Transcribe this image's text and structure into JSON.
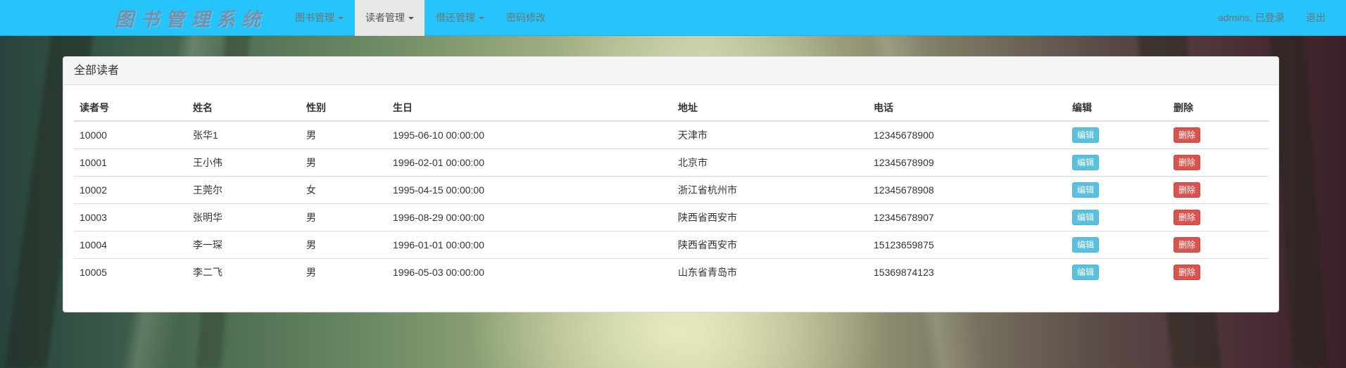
{
  "brand": "图书管理系统",
  "nav": {
    "books": "图书管理",
    "readers": "读者管理",
    "borrow": "借还管理",
    "password": "密码修改",
    "user": "admins, 已登录",
    "logout": "退出"
  },
  "panel": {
    "title": "全部读者"
  },
  "table": {
    "headers": [
      "读者号",
      "姓名",
      "性别",
      "生日",
      "地址",
      "电话",
      "编辑",
      "删除"
    ],
    "rows": [
      {
        "id": "10000",
        "name": "张华1",
        "sex": "男",
        "birth": "1995-06-10 00:00:00",
        "address": "天津市",
        "phone": "12345678900",
        "edit": "编辑",
        "delete": "删除"
      },
      {
        "id": "10001",
        "name": "王小伟",
        "sex": "男",
        "birth": "1996-02-01 00:00:00",
        "address": "北京市",
        "phone": "12345678909",
        "edit": "编辑",
        "delete": "删除"
      },
      {
        "id": "10002",
        "name": "王莞尔",
        "sex": "女",
        "birth": "1995-04-15 00:00:00",
        "address": "浙江省杭州市",
        "phone": "12345678908",
        "edit": "编辑",
        "delete": "删除"
      },
      {
        "id": "10003",
        "name": "张明华",
        "sex": "男",
        "birth": "1996-08-29 00:00:00",
        "address": "陕西省西安市",
        "phone": "12345678907",
        "edit": "编辑",
        "delete": "删除"
      },
      {
        "id": "10004",
        "name": "李一琛",
        "sex": "男",
        "birth": "1996-01-01 00:00:00",
        "address": "陕西省西安市",
        "phone": "15123659875",
        "edit": "编辑",
        "delete": "删除"
      },
      {
        "id": "10005",
        "name": "李二飞",
        "sex": "男",
        "birth": "1996-05-03 00:00:00",
        "address": "山东省青岛市",
        "phone": "15369874123",
        "edit": "编辑",
        "delete": "删除"
      }
    ]
  },
  "colors": {
    "navbar": "#25c5fb",
    "active_nav": "#e7e7e7",
    "edit_button": "#5bc0de",
    "delete_button": "#d9534f"
  },
  "icons": {
    "dropdown": "caret-down-icon"
  }
}
